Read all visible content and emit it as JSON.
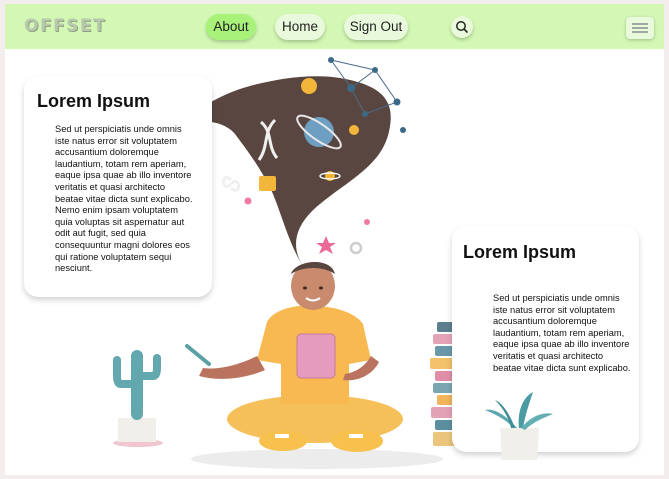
{
  "header": {
    "logo": "OFFSET",
    "nav": [
      {
        "label": "About",
        "active": true
      },
      {
        "label": "Home",
        "active": false
      },
      {
        "label": "Sign Out",
        "active": false
      }
    ],
    "search_icon": "search-icon",
    "menu_icon": "hamburger-menu-icon"
  },
  "cards": [
    {
      "title": "Lorem Ipsum",
      "body": "Sed ut perspiciatis unde omnis iste natus error sit voluptatem accusantium doloremque laudantium, totam rem aperiam, eaque ipsa quae ab illo inventore veritatis et quasi architecto beatae vitae dicta sunt explicabo. Nemo enim ipsam voluptatem quia voluptas sit aspernatur aut odit aut fugit, sed quia consequuntur magni dolores eos qui ratione voluptatem sequi nesciunt."
    },
    {
      "title": "Lorem Ipsum",
      "body": "Sed ut perspiciatis unde omnis iste natus error sit voluptatem accusantium doloremque laudantium, totam rem aperiam, eaque ipsa quae ab illo inventore veritatis et quasi architecto beatae vitae dicta sunt explicabo."
    }
  ],
  "colors": {
    "navbar": "#d2f8b4",
    "active_nav": "#a8f27a",
    "background": "#ffffff"
  }
}
